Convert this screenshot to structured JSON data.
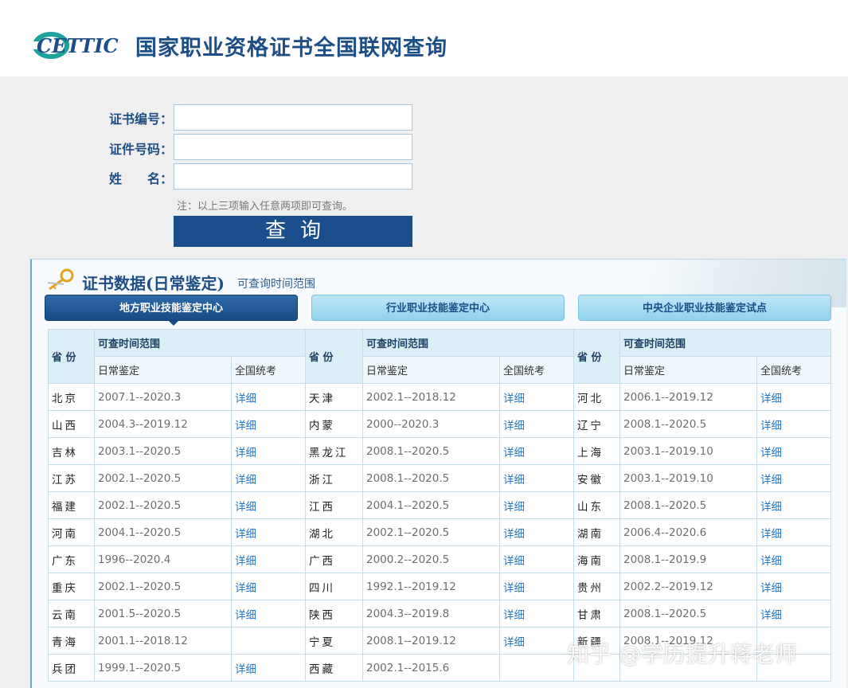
{
  "header": {
    "logo_text": "CETTIC",
    "title": "国家职业资格证书全国联网查询"
  },
  "form": {
    "cert_no_label": "证书编号：",
    "id_no_label": "证件号码：",
    "name_label": "姓　　名：",
    "cert_no_value": "",
    "id_no_value": "",
    "name_value": "",
    "note": "注：以上三项输入任意两项即可查询。",
    "query_button": "查询"
  },
  "panel": {
    "title": "证书数据(日常鉴定)",
    "subtitle": "可查询时间范围",
    "tabs": [
      {
        "label": "地方职业技能鉴定中心",
        "active": true
      },
      {
        "label": "行业职业技能鉴定中心",
        "active": false
      },
      {
        "label": "中央企业职业技能鉴定试点",
        "active": false
      }
    ]
  },
  "table": {
    "province_header": "省 份",
    "range_header": "可查时间范围",
    "daily_header": "日常鉴定",
    "national_header": "全国统考",
    "detail_label": "详细",
    "rows": [
      [
        {
          "p": "北京",
          "r": "2007.1--2020.3",
          "d": true
        },
        {
          "p": "天津",
          "r": "2002.1--2018.12",
          "d": true
        },
        {
          "p": "河北",
          "r": "2006.1--2019.12",
          "d": true
        }
      ],
      [
        {
          "p": "山西",
          "r": "2004.3--2019.12",
          "d": true
        },
        {
          "p": "内蒙",
          "r": "2000--2020.3",
          "d": true
        },
        {
          "p": "辽宁",
          "r": "2008.1--2020.5",
          "d": true
        }
      ],
      [
        {
          "p": "吉林",
          "r": "2003.1--2020.5",
          "d": true
        },
        {
          "p": "黑龙江",
          "r": "2008.1--2020.5",
          "d": true
        },
        {
          "p": "上海",
          "r": "2003.1--2019.10",
          "d": true
        }
      ],
      [
        {
          "p": "江苏",
          "r": "2002.1--2020.5",
          "d": true
        },
        {
          "p": "浙江",
          "r": "2008.1--2020.5",
          "d": true
        },
        {
          "p": "安徽",
          "r": "2003.1--2019.10",
          "d": true
        }
      ],
      [
        {
          "p": "福建",
          "r": "2002.1--2020.5",
          "d": true
        },
        {
          "p": "江西",
          "r": "2004.1--2020.5",
          "d": true
        },
        {
          "p": "山东",
          "r": "2008.1--2020.5",
          "d": true
        }
      ],
      [
        {
          "p": "河南",
          "r": "2004.1--2020.5",
          "d": true
        },
        {
          "p": "湖北",
          "r": "2002.1--2020.5",
          "d": true
        },
        {
          "p": "湖南",
          "r": "2006.4--2020.6",
          "d": true
        }
      ],
      [
        {
          "p": "广东",
          "r": "1996--2020.4",
          "d": true
        },
        {
          "p": "广西",
          "r": "2000.2--2020.5",
          "d": true
        },
        {
          "p": "海南",
          "r": "2008.1--2019.9",
          "d": true
        }
      ],
      [
        {
          "p": "重庆",
          "r": "2002.1--2020.5",
          "d": true
        },
        {
          "p": "四川",
          "r": "1992.1--2019.12",
          "d": true
        },
        {
          "p": "贵州",
          "r": "2002.2--2019.12",
          "d": true
        }
      ],
      [
        {
          "p": "云南",
          "r": "2001.5--2020.5",
          "d": true
        },
        {
          "p": "陕西",
          "r": "2004.3--2019.8",
          "d": true
        },
        {
          "p": "甘肃",
          "r": "2008.1--2020.5",
          "d": true
        }
      ],
      [
        {
          "p": "青海",
          "r": "2001.1--2018.12",
          "d": false
        },
        {
          "p": "宁夏",
          "r": "2008.1--2019.12",
          "d": true
        },
        {
          "p": "新疆",
          "r": "2008.1--2019.12",
          "d": false
        }
      ],
      [
        {
          "p": "兵团",
          "r": "1999.1--2020.5",
          "d": true
        },
        {
          "p": "西藏",
          "r": "2002.1--2015.6",
          "d": false
        },
        {
          "p": "",
          "r": "",
          "d": false
        }
      ]
    ]
  },
  "watermark": "知乎 @学历提升蒋老师",
  "colors": {
    "brand_blue": "#1e4e86",
    "button_blue": "#1b4f8b",
    "link_blue": "#2478c8",
    "tab_light": "#8fd2ee",
    "page_gray": "#efefef"
  }
}
